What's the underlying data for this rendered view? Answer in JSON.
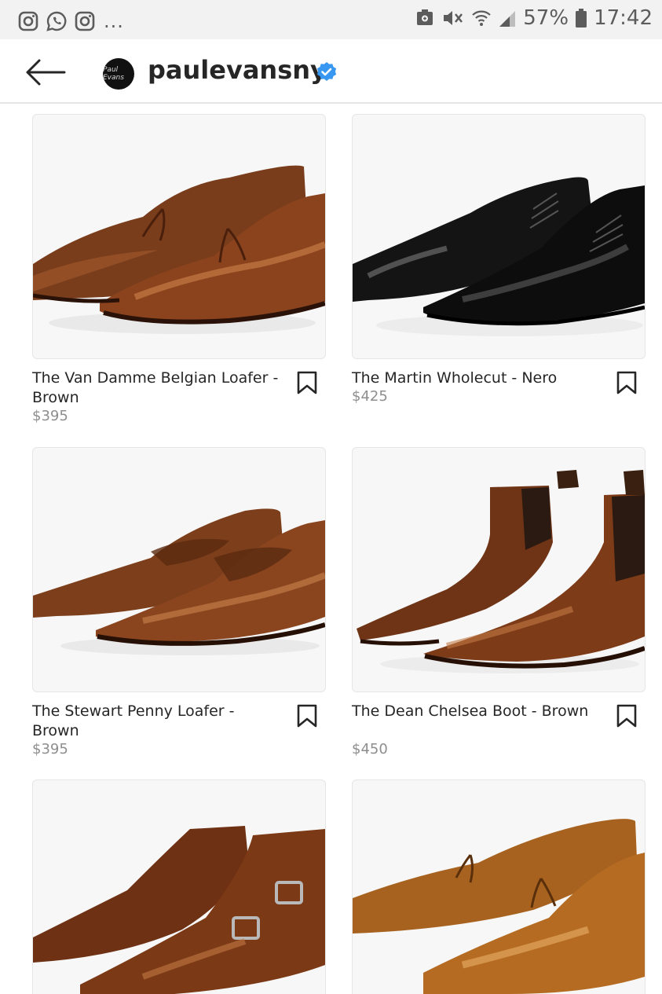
{
  "status_bar": {
    "battery": "57%",
    "time": "17:42",
    "overflow": "...",
    "icons": [
      "instagram-icon",
      "whatsapp-icon",
      "instagram-icon",
      "screenshot-icon",
      "mute-icon",
      "wifi-icon",
      "signal-icon",
      "battery-icon"
    ]
  },
  "header": {
    "username": "paulevansny",
    "avatar_text": "Paul Evans",
    "verified": true
  },
  "products": [
    {
      "title": "The Van Damme Belgian Loafer - Brown",
      "price": "$395",
      "image": "brown-tassel-loafer"
    },
    {
      "title": "The Martin Wholecut - Nero",
      "price": "$425",
      "image": "black-wholecut-oxford"
    },
    {
      "title": "The Stewart Penny Loafer - Brown",
      "price": "$395",
      "image": "brown-penny-loafer"
    },
    {
      "title": "The Dean Chelsea Boot - Brown",
      "price": "$450",
      "image": "brown-chelsea-boot"
    },
    {
      "title": "",
      "price": "",
      "image": "brown-double-monk-strap"
    },
    {
      "title": "",
      "price": "",
      "image": "tan-tassel-loafer"
    }
  ],
  "colors": {
    "accent": "#3897f0",
    "text": "#262626",
    "muted": "#8e8e8e"
  }
}
